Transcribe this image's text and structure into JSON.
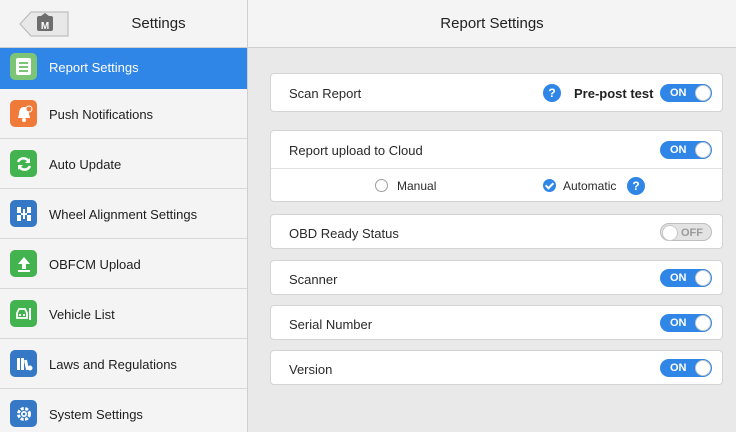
{
  "left_header": {
    "title": "Settings",
    "home_icon_letter": "M"
  },
  "right_header": {
    "title": "Report Settings"
  },
  "sidebar": {
    "items": [
      {
        "label": "Report Settings",
        "icon": "report-icon",
        "color": "#7cc576",
        "active": true
      },
      {
        "label": "Push Notifications",
        "icon": "bell-icon",
        "color": "#f07a3a",
        "active": false
      },
      {
        "label": "Auto Update",
        "icon": "refresh-icon",
        "color": "#43b34f",
        "active": false
      },
      {
        "label": "Wheel Alignment Settings",
        "icon": "wheel-alignment-icon",
        "color": "#3478c6",
        "active": false
      },
      {
        "label": "OBFCM Upload",
        "icon": "upload-icon",
        "color": "#43b34f",
        "active": false
      },
      {
        "label": "Vehicle List",
        "icon": "vehicle-list-icon",
        "color": "#43b34f",
        "active": false
      },
      {
        "label": "Laws and Regulations",
        "icon": "books-icon",
        "color": "#3478c6",
        "active": false
      },
      {
        "label": "System Settings",
        "icon": "gear-icon",
        "color": "#3478c6",
        "active": false
      }
    ]
  },
  "settings": {
    "scan_report": {
      "label": "Scan Report",
      "extra_label": "Pre-post test",
      "help": "?",
      "toggle": "ON"
    },
    "cloud": {
      "label": "Report upload to Cloud",
      "toggle": "ON",
      "options": [
        {
          "label": "Manual",
          "checked": false
        },
        {
          "label": "Automatic",
          "checked": true
        }
      ],
      "help": "?"
    },
    "obd": {
      "label": "OBD Ready Status",
      "toggle": "OFF"
    },
    "scanner": {
      "label": "Scanner",
      "toggle": "ON"
    },
    "serial": {
      "label": "Serial Number",
      "toggle": "ON"
    },
    "version": {
      "label": "Version",
      "toggle": "ON"
    }
  },
  "colors": {
    "accent": "#2f86e6",
    "background": "#e9e9e9",
    "panel": "#f4f4f4"
  }
}
